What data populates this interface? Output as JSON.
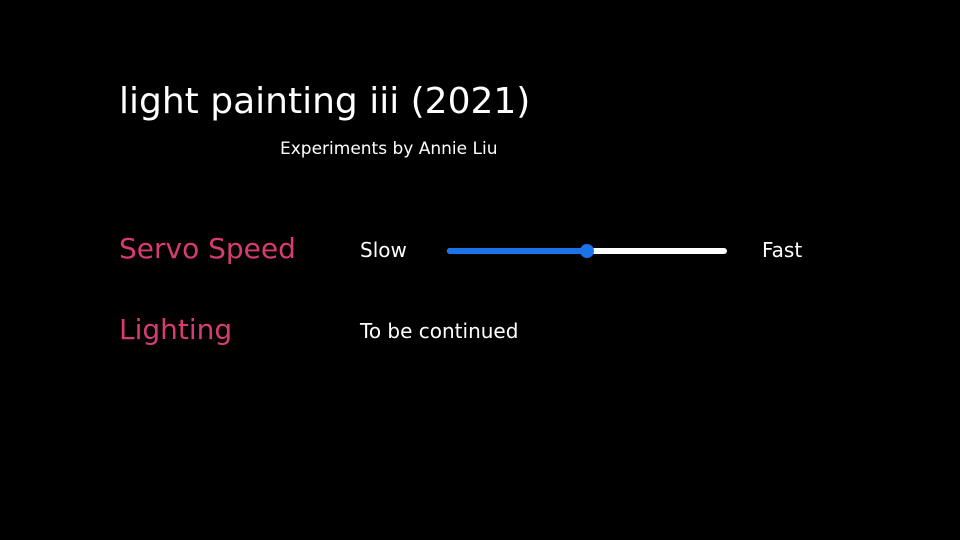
{
  "header": {
    "title": "light painting iii (2021)",
    "subtitle": "Experiments by Annie Liu"
  },
  "servo_speed": {
    "label": "Servo Speed",
    "min_label": "Slow",
    "max_label": "Fast",
    "value_fraction": 0.5
  },
  "lighting": {
    "label": "Lighting",
    "status": "To be continued"
  },
  "colors": {
    "background": "#000000",
    "text": "#ffffff",
    "accent_label": "#d63c73",
    "slider_fill": "#1a73e8",
    "slider_track": "#ffffff"
  }
}
